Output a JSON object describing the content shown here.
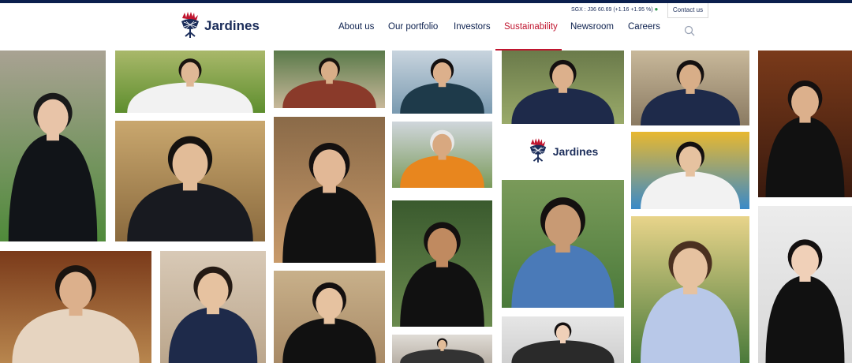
{
  "header": {
    "logo_text": "Jardines",
    "ticker_label": "SGX : J36",
    "ticker_price": "60.69",
    "ticker_change": "(+1.16 +1.95 %)",
    "contact_label": "Contact us",
    "nav": [
      {
        "label": "About us",
        "active": false
      },
      {
        "label": "Our portfolio",
        "active": false
      },
      {
        "label": "Investors",
        "active": false
      },
      {
        "label": "Sustainability",
        "active": true
      },
      {
        "label": "Newsroom",
        "active": false
      },
      {
        "label": "Careers",
        "active": false
      }
    ],
    "search_icon": "search-icon"
  },
  "brand_card": {
    "logo_text": "Jardines"
  },
  "colors": {
    "navy": "#0b1f4d",
    "accent_red": "#c0152f",
    "ticker_up": "#2e9a4c"
  },
  "gallery": {
    "photo_count": 22
  }
}
